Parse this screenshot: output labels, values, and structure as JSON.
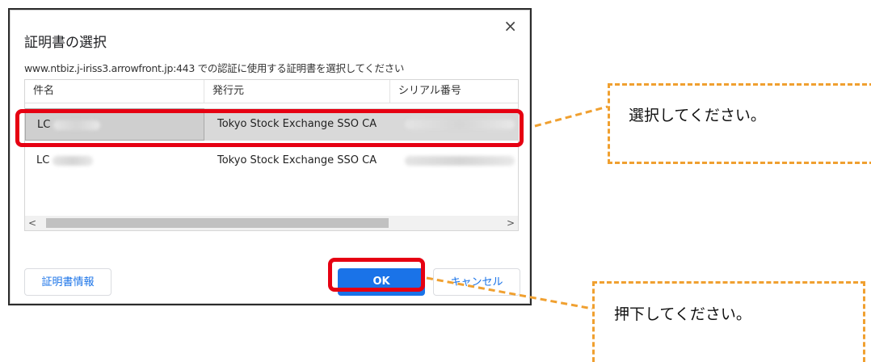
{
  "dialog": {
    "title": "証明書の選択",
    "subtitle": "www.ntbiz.j-iriss3.arrowfront.jp:443 での認証に使用する証明書を選択してください",
    "close_glyph": "×",
    "columns": [
      "件名",
      "発行元",
      "シリアル番号"
    ],
    "rows": [
      {
        "subject": "LC",
        "issuer": "Tokyo Stock Exchange SSO CA",
        "selected": true
      },
      {
        "subject": "LC",
        "issuer": "Tokyo Stock Exchange SSO CA",
        "selected": false
      }
    ],
    "scroll_left": "<",
    "scroll_right": ">",
    "buttons": {
      "cert_info": "証明書情報",
      "ok": "OK",
      "cancel": "キャンセル"
    }
  },
  "callouts": {
    "select": "選択してください。",
    "press": "押下してください。"
  },
  "colors": {
    "highlight": "#e60012",
    "callout_border": "#f0a030",
    "primary": "#1a73e8"
  }
}
